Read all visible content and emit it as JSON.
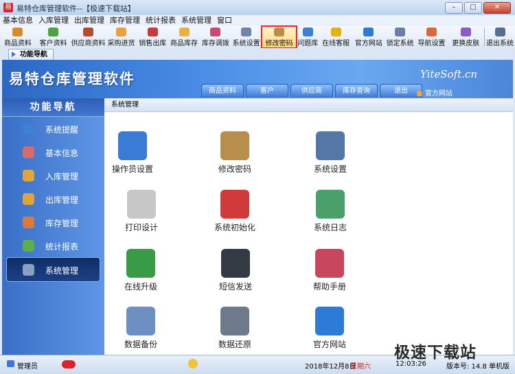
{
  "window": {
    "title": "易特仓库管理软件--【极速下载站】"
  },
  "menubar": {
    "items": [
      "基本信息",
      "入库管理",
      "出库管理",
      "库存管理",
      "统计报表",
      "系统管理",
      "窗口"
    ]
  },
  "toolbar": {
    "items": [
      {
        "label": "商品资料",
        "color": "#d98b2b"
      },
      {
        "label": "客户资料",
        "color": "#4aa545"
      },
      {
        "label": "供应商资料",
        "color": "#b44b33"
      },
      {
        "label": "采购进货",
        "color": "#e8a33c"
      },
      {
        "label": "销售出库",
        "color": "#c73b3b"
      },
      {
        "label": "商品库存",
        "color": "#e7b23f"
      },
      {
        "label": "库存调拨",
        "color": "#c94a70"
      },
      {
        "label": "系统设置",
        "color": "#6f86a8"
      },
      {
        "label": "修改密码",
        "color": "#b88f4a"
      },
      {
        "label": "问题库",
        "color": "#3d7fd1"
      },
      {
        "label": "在线客服",
        "color": "#e6b300"
      },
      {
        "label": "官方网站",
        "color": "#2c7bd6"
      },
      {
        "label": "锁定系统",
        "color": "#6b7fa8"
      },
      {
        "label": "导航设置",
        "color": "#d66a3c"
      },
      {
        "label": "更换皮肤",
        "color": "#8c5bc7"
      },
      {
        "label": "退出系统",
        "color": "#5b6e8f"
      }
    ]
  },
  "doc_tab": {
    "label": "功能导航"
  },
  "banner": {
    "title": "易特仓库管理软件",
    "brand": "YiteSoft.cn",
    "home_link": "官方网站",
    "tabs": [
      "商品资料",
      "客户",
      "供应商",
      "库存查询",
      "退出"
    ]
  },
  "sidebar": {
    "header": "功能导航",
    "items": [
      {
        "label": "系统提醒",
        "color": "#3f7fd6"
      },
      {
        "label": "基本信息",
        "color": "#d96a6a"
      },
      {
        "label": "入库管理",
        "color": "#e0a43d"
      },
      {
        "label": "出库管理",
        "color": "#e0a43d"
      },
      {
        "label": "库存管理",
        "color": "#d97a3c"
      },
      {
        "label": "统计报表",
        "color": "#5bb04b"
      },
      {
        "label": "系统管理",
        "color": "#8aa0c0"
      }
    ]
  },
  "breadcrumb": "系统管理",
  "tiles": [
    {
      "label": "操作员设置",
      "color": "#3a7bd5"
    },
    {
      "label": "修改密码",
      "color": "#b88f4a"
    },
    {
      "label": "系统设置",
      "color": "#5577a8"
    },
    {
      "label": "打印设计",
      "color": "#c7c7c7"
    },
    {
      "label": "系统初始化",
      "color": "#d03a3a"
    },
    {
      "label": "系统日志",
      "color": "#4aa06b"
    },
    {
      "label": "在线升级",
      "color": "#3a9b47"
    },
    {
      "label": "短信发送",
      "color": "#333a44"
    },
    {
      "label": "帮助手册",
      "color": "#c9475c"
    },
    {
      "label": "数据备份",
      "color": "#6d8fc2"
    },
    {
      "label": "数据还原",
      "color": "#6e7a8c"
    },
    {
      "label": "官方网站",
      "color": "#2c7bd6"
    }
  ],
  "status": {
    "user": "管理员",
    "date": "2018年12月8日",
    "weekday": "星期六",
    "time": "12:03:26",
    "version": "版本号: 14.8 单机版"
  },
  "watermark": "极速下载站"
}
